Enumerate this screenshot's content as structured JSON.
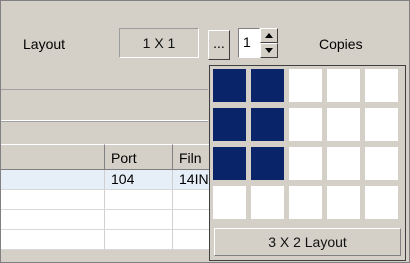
{
  "toolbar": {
    "layout_label": "Layout",
    "layout_value": "1 X 1",
    "browse_label": "...",
    "copies_value": "1",
    "copies_label": "Copies"
  },
  "table": {
    "columns": [
      "",
      "Port",
      "Filn"
    ],
    "rows": [
      [
        "",
        "104",
        "14IN"
      ],
      [
        "",
        "",
        ""
      ],
      [
        "",
        "",
        ""
      ],
      [
        "",
        "",
        ""
      ]
    ]
  },
  "layout_picker": {
    "columns": 5,
    "rows": 4,
    "selected_columns": 2,
    "selected_rows": 3,
    "button_label": "3 X 2 Layout",
    "selected_color": "#0a246a"
  },
  "icons": {
    "spin_up": "spin-up-arrow-icon",
    "spin_down": "spin-down-arrow-icon"
  }
}
